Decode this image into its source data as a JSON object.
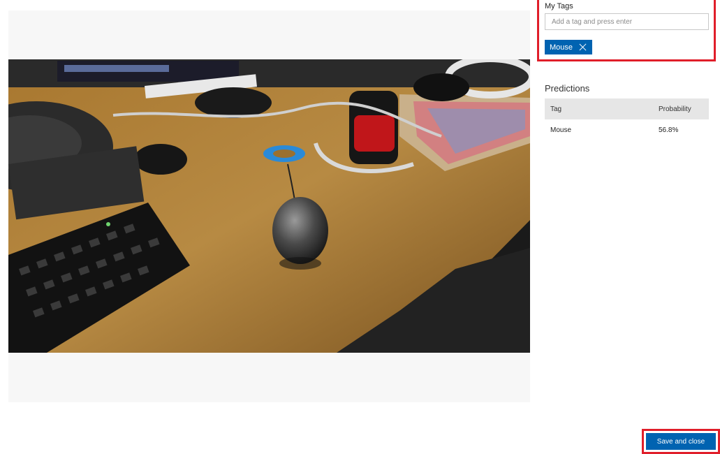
{
  "tags": {
    "title": "My Tags",
    "input_placeholder": "Add a tag and press enter",
    "chips": [
      {
        "label": "Mouse"
      }
    ]
  },
  "predictions": {
    "title": "Predictions",
    "columns": {
      "tag": "Tag",
      "probability": "Probability"
    },
    "rows": [
      {
        "tag": "Mouse",
        "probability": "56.8%"
      }
    ]
  },
  "actions": {
    "save_label": "Save and close"
  },
  "colors": {
    "accent": "#0063b1",
    "highlight": "#e01e2a"
  },
  "image": {
    "subject": "photo of a wooden desk with a computer mouse, keyboard and cup"
  }
}
